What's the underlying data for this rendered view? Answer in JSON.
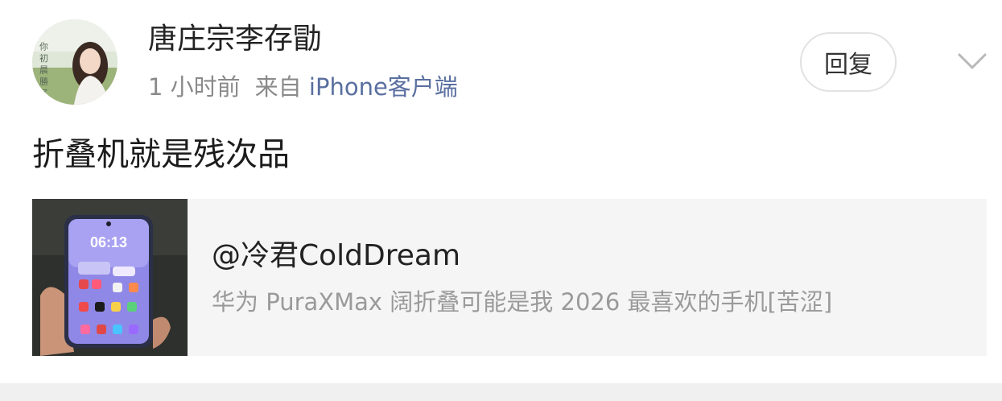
{
  "post": {
    "user_name": "唐庄宗李存勖",
    "time": "1 小时前",
    "source_prefix": "来自",
    "source_client": "iPhone客户端",
    "reply_label": "回复",
    "text": "折叠机就是残次品",
    "avatar_text": "你 初 晨 勝 了 我"
  },
  "repost": {
    "author": "@冷君ColdDream",
    "text": "华为 PuraXMax 阔折叠可能是我 2026 最喜欢的手机[苦涩]",
    "thumb_clock": "06:13"
  },
  "icons": {
    "expand": "chevron-down-icon"
  },
  "colors": {
    "source_client": "#5a6fa0",
    "meta": "#8a8a8a",
    "card_bg": "#f5f5f5"
  }
}
